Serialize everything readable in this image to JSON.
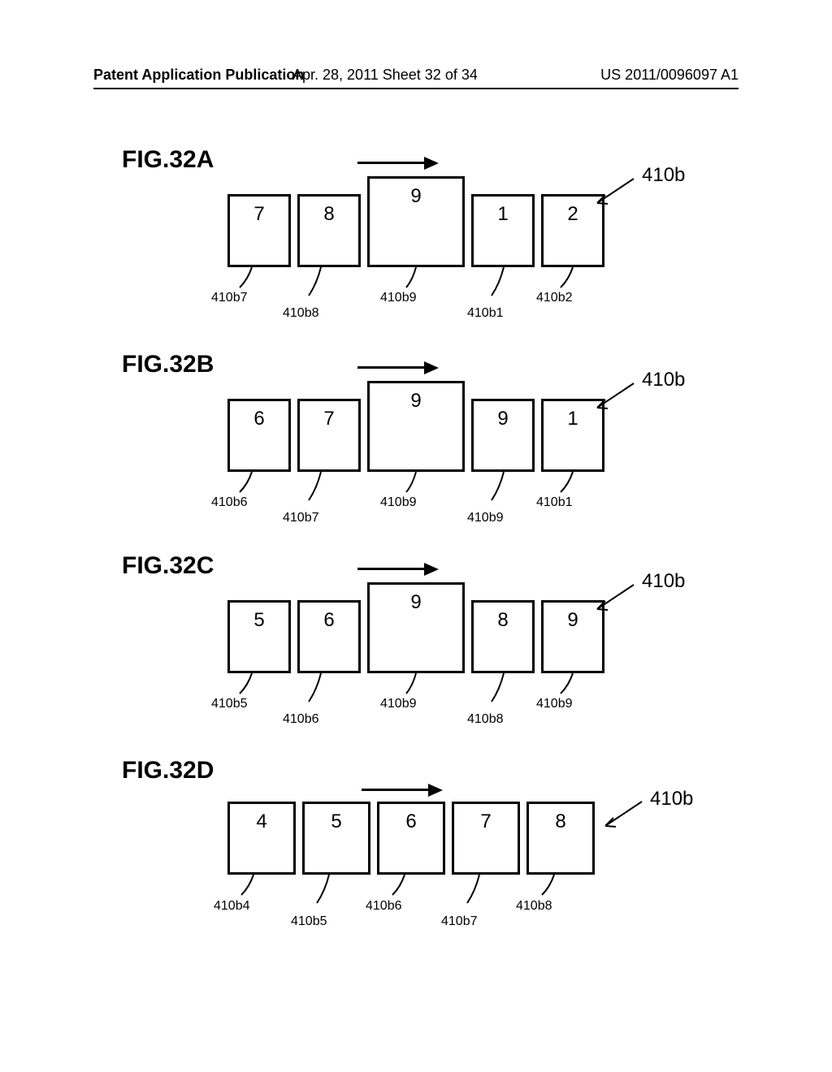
{
  "header": {
    "left": "Patent Application Publication",
    "center": "Apr. 28, 2011  Sheet 32 of 34",
    "right": "US 2011/0096097 A1"
  },
  "figures": {
    "a": {
      "title": "FIG.32A",
      "boxes": [
        "7",
        "8",
        "9",
        "1",
        "2"
      ],
      "labels": [
        "410b7",
        "410b8",
        "410b9",
        "410b1",
        "410b2"
      ],
      "side": "410b"
    },
    "b": {
      "title": "FIG.32B",
      "boxes": [
        "6",
        "7",
        "9",
        "9",
        "1"
      ],
      "labels": [
        "410b6",
        "410b7",
        "410b9",
        "410b9",
        "410b1"
      ],
      "side": "410b"
    },
    "c": {
      "title": "FIG.32C",
      "boxes": [
        "5",
        "6",
        "9",
        "8",
        "9"
      ],
      "labels": [
        "410b5",
        "410b6",
        "410b9",
        "410b8",
        "410b9"
      ],
      "side": "410b"
    },
    "d": {
      "title": "FIG.32D",
      "boxes": [
        "4",
        "5",
        "6",
        "7",
        "8"
      ],
      "labels": [
        "410b4",
        "410b5",
        "410b6",
        "410b7",
        "410b8"
      ],
      "side": "410b"
    }
  }
}
